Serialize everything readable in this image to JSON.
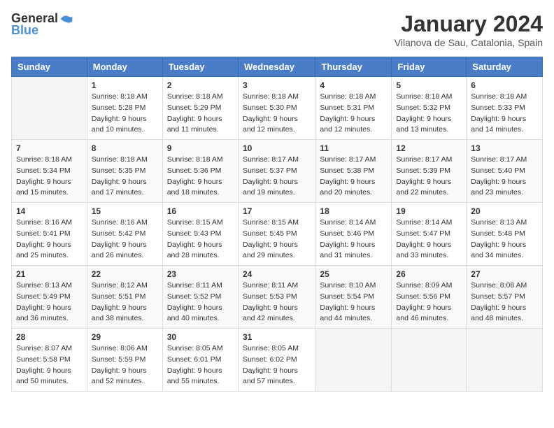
{
  "header": {
    "logo_general": "General",
    "logo_blue": "Blue",
    "month": "January 2024",
    "location": "Vilanova de Sau, Catalonia, Spain"
  },
  "weekdays": [
    "Sunday",
    "Monday",
    "Tuesday",
    "Wednesday",
    "Thursday",
    "Friday",
    "Saturday"
  ],
  "weeks": [
    [
      {
        "day": "",
        "info": ""
      },
      {
        "day": "1",
        "info": "Sunrise: 8:18 AM\nSunset: 5:28 PM\nDaylight: 9 hours\nand 10 minutes."
      },
      {
        "day": "2",
        "info": "Sunrise: 8:18 AM\nSunset: 5:29 PM\nDaylight: 9 hours\nand 11 minutes."
      },
      {
        "day": "3",
        "info": "Sunrise: 8:18 AM\nSunset: 5:30 PM\nDaylight: 9 hours\nand 12 minutes."
      },
      {
        "day": "4",
        "info": "Sunrise: 8:18 AM\nSunset: 5:31 PM\nDaylight: 9 hours\nand 12 minutes."
      },
      {
        "day": "5",
        "info": "Sunrise: 8:18 AM\nSunset: 5:32 PM\nDaylight: 9 hours\nand 13 minutes."
      },
      {
        "day": "6",
        "info": "Sunrise: 8:18 AM\nSunset: 5:33 PM\nDaylight: 9 hours\nand 14 minutes."
      }
    ],
    [
      {
        "day": "7",
        "info": "Sunrise: 8:18 AM\nSunset: 5:34 PM\nDaylight: 9 hours\nand 15 minutes."
      },
      {
        "day": "8",
        "info": "Sunrise: 8:18 AM\nSunset: 5:35 PM\nDaylight: 9 hours\nand 17 minutes."
      },
      {
        "day": "9",
        "info": "Sunrise: 8:18 AM\nSunset: 5:36 PM\nDaylight: 9 hours\nand 18 minutes."
      },
      {
        "day": "10",
        "info": "Sunrise: 8:17 AM\nSunset: 5:37 PM\nDaylight: 9 hours\nand 19 minutes."
      },
      {
        "day": "11",
        "info": "Sunrise: 8:17 AM\nSunset: 5:38 PM\nDaylight: 9 hours\nand 20 minutes."
      },
      {
        "day": "12",
        "info": "Sunrise: 8:17 AM\nSunset: 5:39 PM\nDaylight: 9 hours\nand 22 minutes."
      },
      {
        "day": "13",
        "info": "Sunrise: 8:17 AM\nSunset: 5:40 PM\nDaylight: 9 hours\nand 23 minutes."
      }
    ],
    [
      {
        "day": "14",
        "info": "Sunrise: 8:16 AM\nSunset: 5:41 PM\nDaylight: 9 hours\nand 25 minutes."
      },
      {
        "day": "15",
        "info": "Sunrise: 8:16 AM\nSunset: 5:42 PM\nDaylight: 9 hours\nand 26 minutes."
      },
      {
        "day": "16",
        "info": "Sunrise: 8:15 AM\nSunset: 5:43 PM\nDaylight: 9 hours\nand 28 minutes."
      },
      {
        "day": "17",
        "info": "Sunrise: 8:15 AM\nSunset: 5:45 PM\nDaylight: 9 hours\nand 29 minutes."
      },
      {
        "day": "18",
        "info": "Sunrise: 8:14 AM\nSunset: 5:46 PM\nDaylight: 9 hours\nand 31 minutes."
      },
      {
        "day": "19",
        "info": "Sunrise: 8:14 AM\nSunset: 5:47 PM\nDaylight: 9 hours\nand 33 minutes."
      },
      {
        "day": "20",
        "info": "Sunrise: 8:13 AM\nSunset: 5:48 PM\nDaylight: 9 hours\nand 34 minutes."
      }
    ],
    [
      {
        "day": "21",
        "info": "Sunrise: 8:13 AM\nSunset: 5:49 PM\nDaylight: 9 hours\nand 36 minutes."
      },
      {
        "day": "22",
        "info": "Sunrise: 8:12 AM\nSunset: 5:51 PM\nDaylight: 9 hours\nand 38 minutes."
      },
      {
        "day": "23",
        "info": "Sunrise: 8:11 AM\nSunset: 5:52 PM\nDaylight: 9 hours\nand 40 minutes."
      },
      {
        "day": "24",
        "info": "Sunrise: 8:11 AM\nSunset: 5:53 PM\nDaylight: 9 hours\nand 42 minutes."
      },
      {
        "day": "25",
        "info": "Sunrise: 8:10 AM\nSunset: 5:54 PM\nDaylight: 9 hours\nand 44 minutes."
      },
      {
        "day": "26",
        "info": "Sunrise: 8:09 AM\nSunset: 5:56 PM\nDaylight: 9 hours\nand 46 minutes."
      },
      {
        "day": "27",
        "info": "Sunrise: 8:08 AM\nSunset: 5:57 PM\nDaylight: 9 hours\nand 48 minutes."
      }
    ],
    [
      {
        "day": "28",
        "info": "Sunrise: 8:07 AM\nSunset: 5:58 PM\nDaylight: 9 hours\nand 50 minutes."
      },
      {
        "day": "29",
        "info": "Sunrise: 8:06 AM\nSunset: 5:59 PM\nDaylight: 9 hours\nand 52 minutes."
      },
      {
        "day": "30",
        "info": "Sunrise: 8:05 AM\nSunset: 6:01 PM\nDaylight: 9 hours\nand 55 minutes."
      },
      {
        "day": "31",
        "info": "Sunrise: 8:05 AM\nSunset: 6:02 PM\nDaylight: 9 hours\nand 57 minutes."
      },
      {
        "day": "",
        "info": ""
      },
      {
        "day": "",
        "info": ""
      },
      {
        "day": "",
        "info": ""
      }
    ]
  ]
}
